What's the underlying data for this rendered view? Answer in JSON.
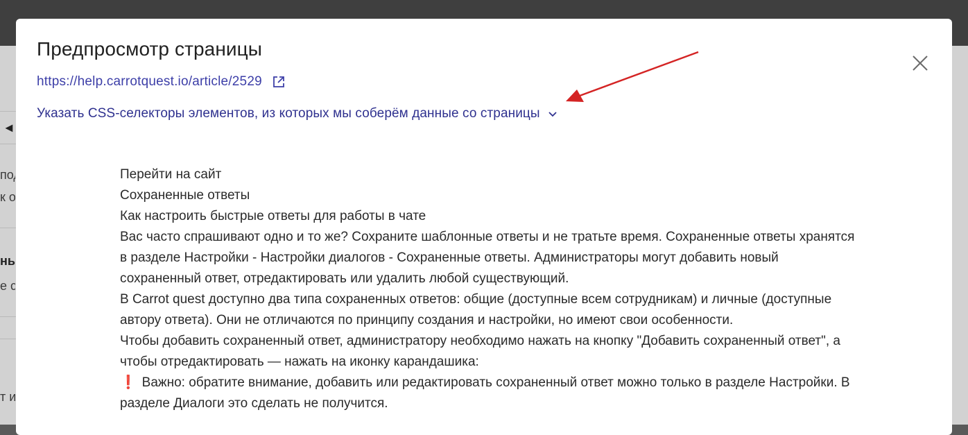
{
  "modal": {
    "title": "Предпросмотр страницы",
    "url": "https://help.carrotquest.io/article/2529",
    "selectors_label": "Указать CSS-селекторы элементов, из которых мы соберём данные со страницы",
    "icons": {
      "close": "close-icon",
      "external": "external-link-icon",
      "chevron": "chevron-down-icon"
    }
  },
  "background_fragments": [
    "под",
    "к о",
    "ны",
    "е ст",
    "т и"
  ],
  "article": {
    "lines": [
      "Перейти на сайт",
      "Сохраненные ответы",
      "Как настроить быстрые ответы для работы в чате",
      "Вас часто спрашивают одно и то же? Сохраните шаблонные ответы и не тратьте время. Сохраненные ответы хранятся в разделе Настройки - Настройки диалогов - Сохраненные ответы. Администраторы могут добавить новый сохраненный ответ, отредактировать или удалить любой существующий.",
      "В Carrot quest доступно два типа сохраненных ответов: общие (доступные всем сотрудникам) и личные (доступные автору ответа). Они не отличаются по принципу создания и настройки, но имеют свои особенности.",
      "Чтобы добавить сохраненный ответ, администратору необходимо нажать на кнопку \"Добавить сохраненный ответ\", а чтобы отредактировать — нажать на иконку карандашика:"
    ],
    "warning_mark": "❗",
    "warning": "Важно: обратите внимание, добавить или редактировать сохраненный ответ можно только в разделе Настройки. В разделе Диалоги это сделать не получится."
  },
  "colors": {
    "link": "#3d3fa8",
    "annotation_arrow": "#d42424",
    "overlay": "#5a5a5a"
  }
}
